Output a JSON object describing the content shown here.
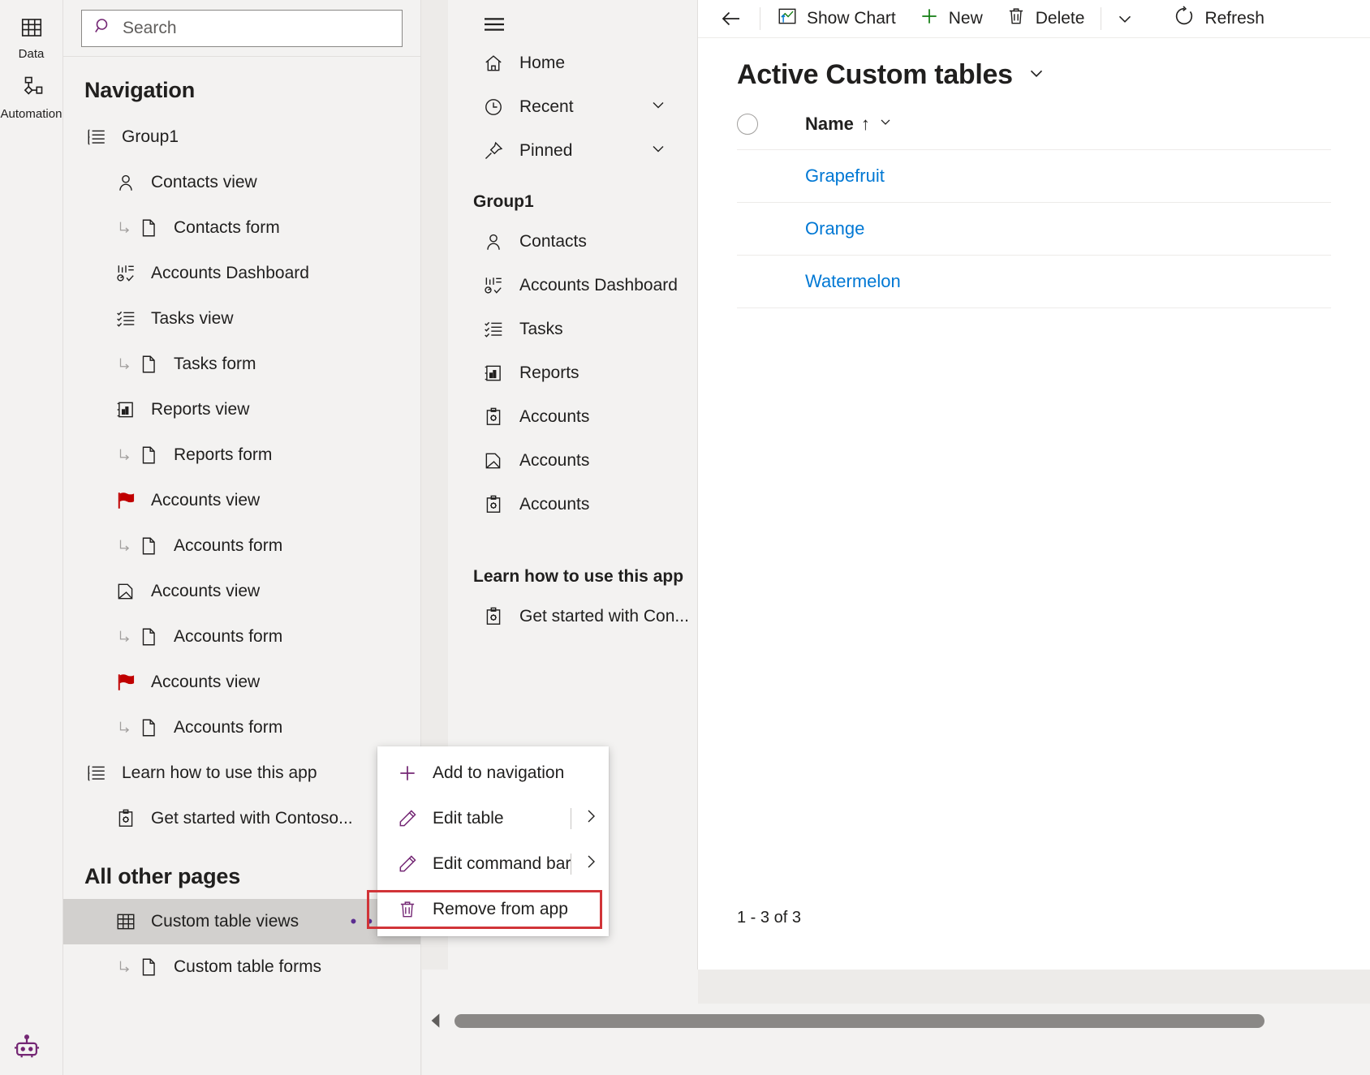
{
  "rail": {
    "items": [
      {
        "label": "Data",
        "icon": "table-icon"
      },
      {
        "label": "Automation",
        "icon": "flow-icon"
      }
    ],
    "bottom_icon": "bot-icon"
  },
  "search": {
    "placeholder": "Search",
    "value": "",
    "icon": "search-icon"
  },
  "navigation": {
    "title": "Navigation",
    "tree": [
      {
        "label": "Group1",
        "icon": "group-list-icon",
        "level": "group"
      },
      {
        "label": "Contacts view",
        "icon": "person-icon",
        "level": "child"
      },
      {
        "label": "Contacts form",
        "icon": "page-icon",
        "level": "sub"
      },
      {
        "label": "Accounts Dashboard",
        "icon": "dashboard-icon",
        "level": "child"
      },
      {
        "label": "Tasks view",
        "icon": "tasklist-icon",
        "level": "child"
      },
      {
        "label": "Tasks form",
        "icon": "page-icon",
        "level": "sub"
      },
      {
        "label": "Reports view",
        "icon": "report-icon",
        "level": "child"
      },
      {
        "label": "Reports form",
        "icon": "page-icon",
        "level": "sub"
      },
      {
        "label": "Accounts view",
        "icon": "red-flag-icon",
        "level": "child"
      },
      {
        "label": "Accounts form",
        "icon": "page-icon",
        "level": "sub"
      },
      {
        "label": "Accounts view",
        "icon": "folder-open-icon",
        "level": "child"
      },
      {
        "label": "Accounts form",
        "icon": "page-icon",
        "level": "sub"
      },
      {
        "label": "Accounts view",
        "icon": "red-flag-icon",
        "level": "child"
      },
      {
        "label": "Accounts form",
        "icon": "page-icon",
        "level": "sub"
      },
      {
        "label": "Learn how to use this app",
        "icon": "group-list-icon",
        "level": "group"
      },
      {
        "label": "Get started with Contoso...",
        "icon": "clipboard-gear-icon",
        "level": "child"
      }
    ],
    "all_other_pages_title": "All other pages",
    "other_pages": [
      {
        "label": "Custom table views",
        "icon": "table-grid-icon",
        "level": "child",
        "selected": true,
        "overflow": "• • •"
      },
      {
        "label": "Custom table forms",
        "icon": "page-icon",
        "level": "sub",
        "selected": false
      }
    ]
  },
  "context_menu": {
    "items": [
      {
        "label": "Add to navigation",
        "icon": "plus-icon",
        "has_submenu": false
      },
      {
        "label": "Edit table",
        "icon": "pencil-icon",
        "has_submenu": true
      },
      {
        "label": "Edit command bar",
        "icon": "pencil-icon",
        "has_submenu": true
      },
      {
        "label": "Remove from app",
        "icon": "trash-icon",
        "has_submenu": false,
        "highlighted": true
      }
    ],
    "highlight_color": "#d13438"
  },
  "preview": {
    "hamburger_icon": "hamburger-icon",
    "top_items": [
      {
        "label": "Home",
        "icon": "home-icon",
        "chevron": false
      },
      {
        "label": "Recent",
        "icon": "clock-icon",
        "chevron": true
      },
      {
        "label": "Pinned",
        "icon": "pin-icon",
        "chevron": true
      }
    ],
    "group_label": "Group1",
    "group_items": [
      {
        "label": "Contacts",
        "icon": "person-icon"
      },
      {
        "label": "Accounts Dashboard",
        "icon": "dashboard-icon"
      },
      {
        "label": "Tasks",
        "icon": "tasklist-icon"
      },
      {
        "label": "Reports",
        "icon": "report-icon"
      },
      {
        "label": "Accounts",
        "icon": "clipboard-gear-icon"
      },
      {
        "label": "Accounts",
        "icon": "folder-open-icon"
      },
      {
        "label": "Accounts",
        "icon": "clipboard-gear-icon"
      }
    ],
    "learn_label": "Learn how to use this app",
    "learn_items": [
      {
        "label": "Get started with Con...",
        "icon": "clipboard-gear-icon"
      }
    ]
  },
  "main": {
    "commandbar": {
      "back_icon": "back-arrow-icon",
      "buttons": [
        {
          "label": "Show Chart",
          "icon": "chart-icon"
        },
        {
          "label": "New",
          "icon": "plus-icon"
        },
        {
          "label": "Delete",
          "icon": "trash-icon"
        }
      ],
      "more_icon": "chevron-down-icon",
      "refresh": {
        "label": "Refresh",
        "icon": "refresh-icon"
      }
    },
    "view_title": "Active Custom tables",
    "view_title_chevron": "chevron-down-icon",
    "grid": {
      "select_all_icon": "select-circle-icon",
      "columns": [
        {
          "label": "Name",
          "sort": "↑",
          "chevron": "chevron-down-icon"
        }
      ],
      "rows": [
        {
          "name": "Grapefruit"
        },
        {
          "name": "Orange"
        },
        {
          "name": "Watermelon"
        }
      ]
    },
    "record_count": "1 - 3 of 3",
    "link_color": "#0078d4"
  },
  "scrollbar": {
    "left_arrow_icon": "caret-left-icon"
  }
}
